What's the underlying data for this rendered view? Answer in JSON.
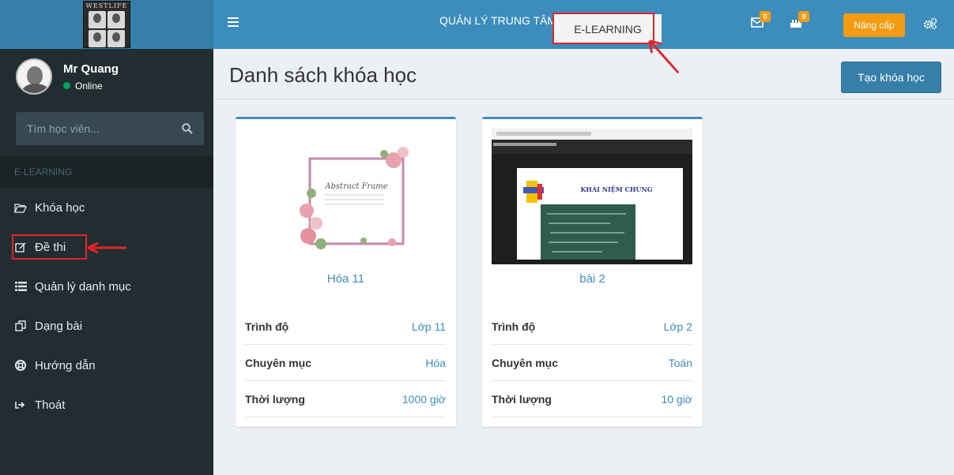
{
  "logo": {
    "text": "WESTLIFE"
  },
  "user": {
    "name": "Mr Quang",
    "status": "Online"
  },
  "search": {
    "placeholder": "Tìm học viên..."
  },
  "sidebar": {
    "header": "E-LEARNING",
    "items": [
      {
        "label": "Khóa học",
        "icon": "folder-open-icon"
      },
      {
        "label": "Đề thi",
        "icon": "edit-icon"
      },
      {
        "label": "Quản lý danh mục",
        "icon": "list-icon"
      },
      {
        "label": "Dạng bài",
        "icon": "copy-icon"
      },
      {
        "label": "Hướng dẫn",
        "icon": "lifebuoy-icon"
      },
      {
        "label": "Thoát",
        "icon": "sign-out-icon"
      }
    ]
  },
  "topbar": {
    "center_link": "QUẢN LÝ TRUNG TÂM",
    "active_tab": "E-LEARNING",
    "mail_badge": "0",
    "bell_badge": "0",
    "upgrade_label": "Nâng cấp"
  },
  "content": {
    "title": "Danh sách khóa học",
    "create_label": "Tạo khóa học"
  },
  "courses": [
    {
      "title": "Hóa 11",
      "thumb_text": "Abstract Frame",
      "rows": [
        {
          "label": "Trình độ",
          "value": "Lớp 11"
        },
        {
          "label": "Chuyên mục",
          "value": "Hóa"
        },
        {
          "label": "Thời lượng",
          "value": "1000 giờ"
        }
      ]
    },
    {
      "title": "bài 2",
      "thumb_text": "KHÁI NIỆM CHUNG",
      "rows": [
        {
          "label": "Trình độ",
          "value": "Lớp 2"
        },
        {
          "label": "Chuyên mục",
          "value": "Toán"
        },
        {
          "label": "Thời lượng",
          "value": "10 giờ"
        }
      ]
    }
  ],
  "colors": {
    "sidebar_bg": "#222d32",
    "topbar_bg": "#3c8dbc",
    "accent": "#3c8dbc",
    "upgrade": "#f39c12",
    "highlight_red": "#e0252b",
    "online": "#00a65a"
  }
}
